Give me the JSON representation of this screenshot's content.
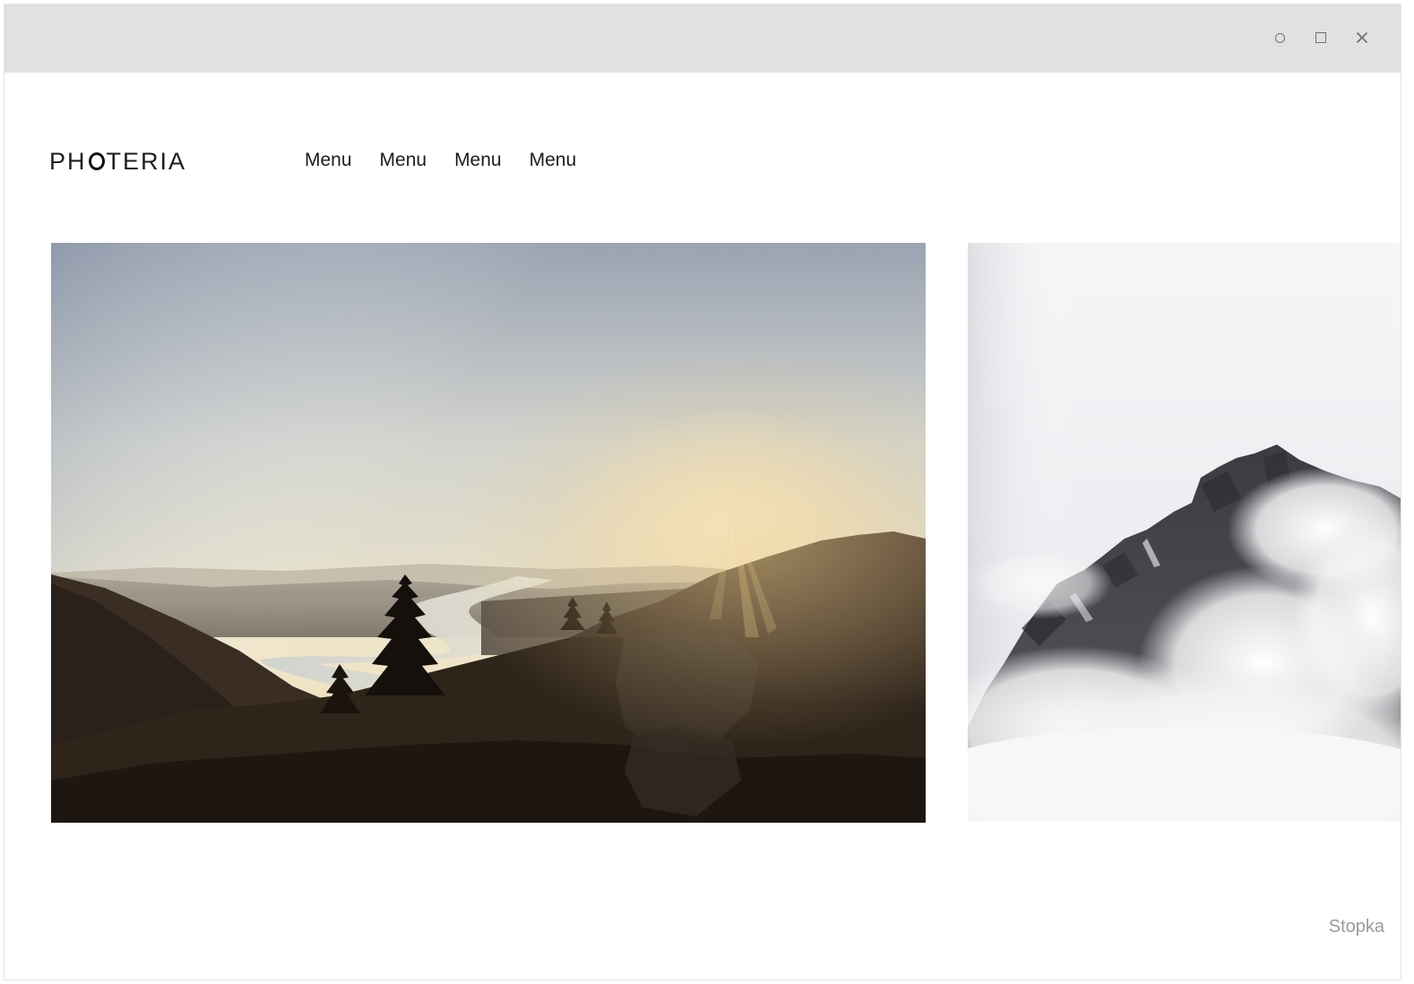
{
  "window": {
    "controls": [
      {
        "name": "minimize",
        "icon": "circle-icon"
      },
      {
        "name": "maximize",
        "icon": "square-icon"
      },
      {
        "name": "close",
        "icon": "close-icon"
      }
    ]
  },
  "header": {
    "logo_before": "PH",
    "logo_after": "TERIA",
    "nav": [
      "Menu",
      "Menu",
      "Menu",
      "Menu"
    ]
  },
  "gallery": {
    "images": [
      {
        "name": "sunset-valley-river-photo"
      },
      {
        "name": "mountain-peak-clouds-photo"
      }
    ]
  },
  "footer": {
    "label": "Stopka"
  },
  "colors": {
    "titlebar": "#e1e1e1",
    "text": "#1d1d1d",
    "footer_text": "#9a9a9a"
  }
}
